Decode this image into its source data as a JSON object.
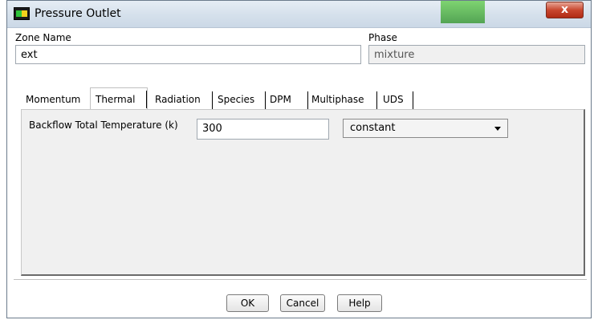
{
  "window": {
    "title": "Pressure Outlet",
    "close_glyph": "x"
  },
  "zone": {
    "label": "Zone Name",
    "value": "ext"
  },
  "phase": {
    "label": "Phase",
    "value": "mixture"
  },
  "tabs": [
    {
      "label": "Momentum"
    },
    {
      "label": "Thermal"
    },
    {
      "label": "Radiation"
    },
    {
      "label": "Species"
    },
    {
      "label": "DPM"
    },
    {
      "label": "Multiphase"
    },
    {
      "label": "UDS"
    }
  ],
  "thermal": {
    "backflow_label": "Backflow Total Temperature (k)",
    "backflow_value": "300",
    "method": "constant"
  },
  "buttons": {
    "ok": "OK",
    "cancel": "Cancel",
    "help": "Help"
  },
  "icons": {
    "app": "fluent-app-icon",
    "close": "close-icon",
    "dropdown": "chevron-down-icon"
  }
}
